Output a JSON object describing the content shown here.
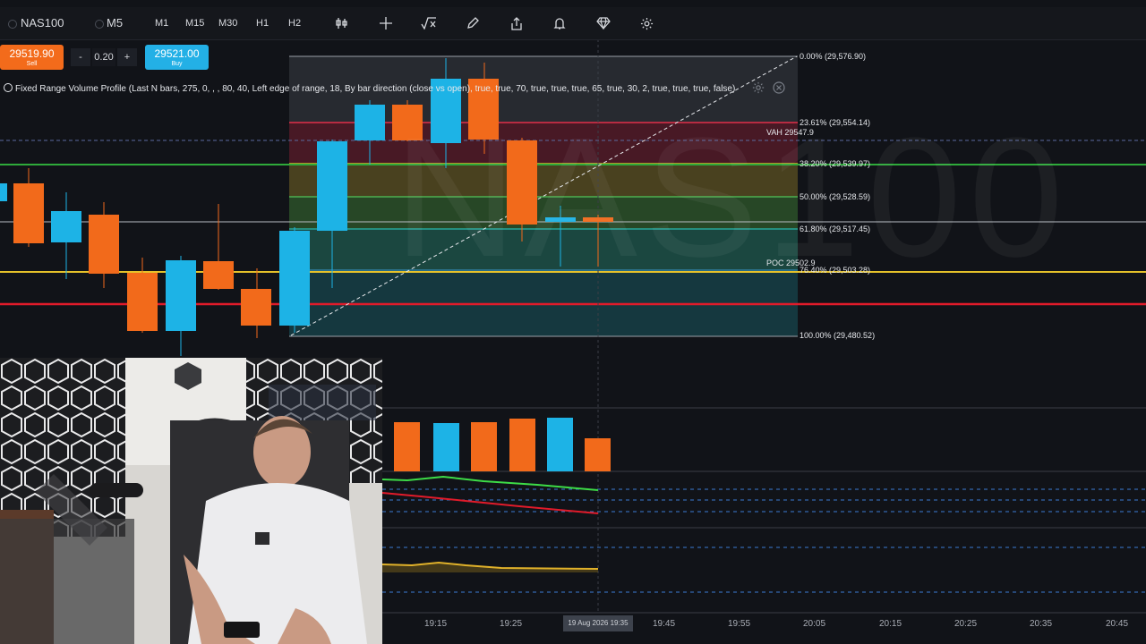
{
  "toolbar": {
    "symbol": "NAS100",
    "interval": "M5",
    "timeframes": [
      "M1",
      "M15",
      "M30",
      "H1",
      "H2"
    ],
    "icons": [
      "indicators-icon",
      "crosshair-icon",
      "function-icon",
      "pencil-icon",
      "share-icon",
      "alert-bell-icon",
      "diamond-icon",
      "gear-icon"
    ]
  },
  "trade": {
    "sell_price": "29519.90",
    "sell_label": "Sell",
    "buy_price": "29521.00",
    "buy_label": "Buy",
    "quantity": "0.20",
    "minus": "-",
    "plus": "+"
  },
  "indicator": {
    "text": "Fixed Range Volume Profile (Last N bars, 275, 0, , , 80, 40, Left edge of range, 18, By bar direction (close vs open), true, true, 70, true, true, true, 65, true, 30, 2, true, true, true, false)"
  },
  "watermark": "NAS100",
  "fib_levels": [
    {
      "label": "0.00% (29,576.90)",
      "color": "#9aa0a8"
    },
    {
      "label": "23.61% (29,554.14)",
      "color": "#e0304a"
    },
    {
      "label": "38.20% (29,539.97)",
      "color": "#d4c12a"
    },
    {
      "label": "50.00% (29,528.59)",
      "color": "#4caf50"
    },
    {
      "label": "61.80% (29,517.45)",
      "color": "#26a69a"
    },
    {
      "label": "76.40% (29,503.28)",
      "color": "#2f7ea0"
    },
    {
      "label": "100.00% (29,480.52)",
      "color": "#9aa0a8"
    }
  ],
  "profile_labels": {
    "vah": "VAH 29547.9",
    "poc": "POC 29502.9"
  },
  "time_axis": {
    "labels": [
      "19:15",
      "19:25",
      "19:45",
      "19:55",
      "20:05",
      "20:15",
      "20:25",
      "20:35",
      "20:45"
    ],
    "current": "19 Aug 2026 19:35"
  },
  "colors": {
    "bull": "#1db3e6",
    "bear": "#f26a1b",
    "background": "#111318"
  }
}
